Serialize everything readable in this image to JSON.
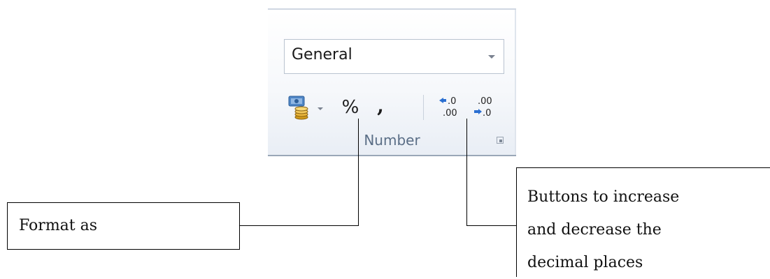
{
  "ribbon": {
    "number_format": {
      "value": "General"
    },
    "buttons": [
      {
        "id": "accounting",
        "label": "",
        "icon": "accounting-number-format-icon"
      },
      {
        "id": "percent",
        "label": "%",
        "icon": "percent-style-icon"
      },
      {
        "id": "comma",
        "label": ",",
        "icon": "comma-style-icon"
      },
      {
        "id": "increase-decimal",
        "label": ".0 / .00",
        "icon": "increase-decimal-icon"
      },
      {
        "id": "decrease-decimal",
        "label": ".00 / .0",
        "icon": "decrease-decimal-icon"
      }
    ],
    "group_label": "Number",
    "launcher_icon": "dialog-launcher-icon",
    "colors": {
      "group_label": "#5a6e86",
      "arrow_blue": "#2a6fd1",
      "border": "#9aa7b7"
    }
  },
  "callouts": {
    "format_as": "Format as",
    "decimal_lines": [
      "Buttons to increase",
      "and decrease the",
      "decimal places"
    ]
  }
}
